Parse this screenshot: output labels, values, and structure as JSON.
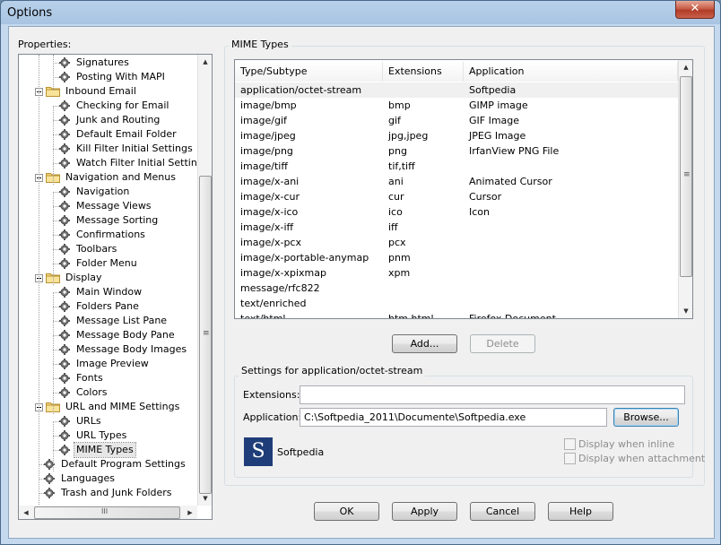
{
  "window": {
    "title": "Options",
    "close_glyph": "✕"
  },
  "properties_label": "Properties:",
  "tree": [
    {
      "label": "Signatures",
      "level": 2,
      "icon": "gear"
    },
    {
      "label": "Posting With MAPI",
      "level": 2,
      "icon": "gear"
    },
    {
      "label": "Inbound Email",
      "level": 1,
      "icon": "folder"
    },
    {
      "label": "Checking for Email",
      "level": 2,
      "icon": "gear"
    },
    {
      "label": "Junk and Routing",
      "level": 2,
      "icon": "gear"
    },
    {
      "label": "Default Email Folder",
      "level": 2,
      "icon": "gear"
    },
    {
      "label": "Kill Filter Initial Settings",
      "level": 2,
      "icon": "gear"
    },
    {
      "label": "Watch Filter Initial Settings",
      "level": 2,
      "icon": "gear"
    },
    {
      "label": "Navigation and Menus",
      "level": 1,
      "icon": "folder"
    },
    {
      "label": "Navigation",
      "level": 2,
      "icon": "gear"
    },
    {
      "label": "Message Views",
      "level": 2,
      "icon": "gear"
    },
    {
      "label": "Message Sorting",
      "level": 2,
      "icon": "gear"
    },
    {
      "label": "Confirmations",
      "level": 2,
      "icon": "gear"
    },
    {
      "label": "Toolbars",
      "level": 2,
      "icon": "gear"
    },
    {
      "label": "Folder Menu",
      "level": 2,
      "icon": "gear"
    },
    {
      "label": "Display",
      "level": 1,
      "icon": "folder"
    },
    {
      "label": "Main Window",
      "level": 2,
      "icon": "gear"
    },
    {
      "label": "Folders Pane",
      "level": 2,
      "icon": "gear"
    },
    {
      "label": "Message List Pane",
      "level": 2,
      "icon": "gear"
    },
    {
      "label": "Message Body Pane",
      "level": 2,
      "icon": "gear"
    },
    {
      "label": "Message Body Images",
      "level": 2,
      "icon": "gear"
    },
    {
      "label": "Image Preview",
      "level": 2,
      "icon": "gear"
    },
    {
      "label": "Fonts",
      "level": 2,
      "icon": "gear"
    },
    {
      "label": "Colors",
      "level": 2,
      "icon": "gear"
    },
    {
      "label": "URL and MIME Settings",
      "level": 1,
      "icon": "folder"
    },
    {
      "label": "URLs",
      "level": 2,
      "icon": "gear"
    },
    {
      "label": "URL Types",
      "level": 2,
      "icon": "gear"
    },
    {
      "label": "MIME Types",
      "level": 2,
      "icon": "gear",
      "selected": true
    },
    {
      "label": "Default Program Settings",
      "level": 1,
      "icon": "gear"
    },
    {
      "label": "Languages",
      "level": 1,
      "icon": "gear"
    },
    {
      "label": "Trash and Junk Folders",
      "level": 1,
      "icon": "gear"
    }
  ],
  "mime_group_title": "MIME Types",
  "mime_columns": [
    "Type/Subtype",
    "Extensions",
    "Application"
  ],
  "mime_rows": [
    [
      "application/octet-stream",
      "",
      "Softpedia"
    ],
    [
      "image/bmp",
      "bmp",
      "GIMP image"
    ],
    [
      "image/gif",
      "gif",
      "GIF Image"
    ],
    [
      "image/jpeg",
      "jpg,jpeg",
      "JPEG Image"
    ],
    [
      "image/png",
      "png",
      "IrfanView PNG File"
    ],
    [
      "image/tiff",
      "tif,tiff",
      ""
    ],
    [
      "image/x-ani",
      "ani",
      "Animated Cursor"
    ],
    [
      "image/x-cur",
      "cur",
      "Cursor"
    ],
    [
      "image/x-ico",
      "ico",
      "Icon"
    ],
    [
      "image/x-iff",
      "iff",
      ""
    ],
    [
      "image/x-pcx",
      "pcx",
      ""
    ],
    [
      "image/x-portable-anymap",
      "pnm",
      ""
    ],
    [
      "image/x-xpixmap",
      "xpm",
      ""
    ],
    [
      "message/rfc822",
      "",
      ""
    ],
    [
      "text/enriched",
      "",
      ""
    ],
    [
      "text/html",
      "htm,html",
      "Firefox Document"
    ]
  ],
  "buttons": {
    "add": "Add...",
    "delete": "Delete",
    "browse": "Browse...",
    "ok": "OK",
    "apply": "Apply",
    "cancel": "Cancel",
    "help": "Help"
  },
  "settings": {
    "title": "Settings for application/octet-stream",
    "extensions_label": "Extensions:",
    "extensions_value": "",
    "application_label": "Application:",
    "application_value": "C:\\Softpedia_2011\\Documente\\Softpedia.exe",
    "app_name": "Softpedia",
    "logo_letter": "S",
    "inline_label": "Display when inline",
    "attachment_label": "Display when attachment"
  },
  "scroll_glyphs": {
    "up": "▲",
    "down": "▼",
    "left": "◀",
    "right": "▶",
    "grip": "≡",
    "hgrip": "III"
  }
}
